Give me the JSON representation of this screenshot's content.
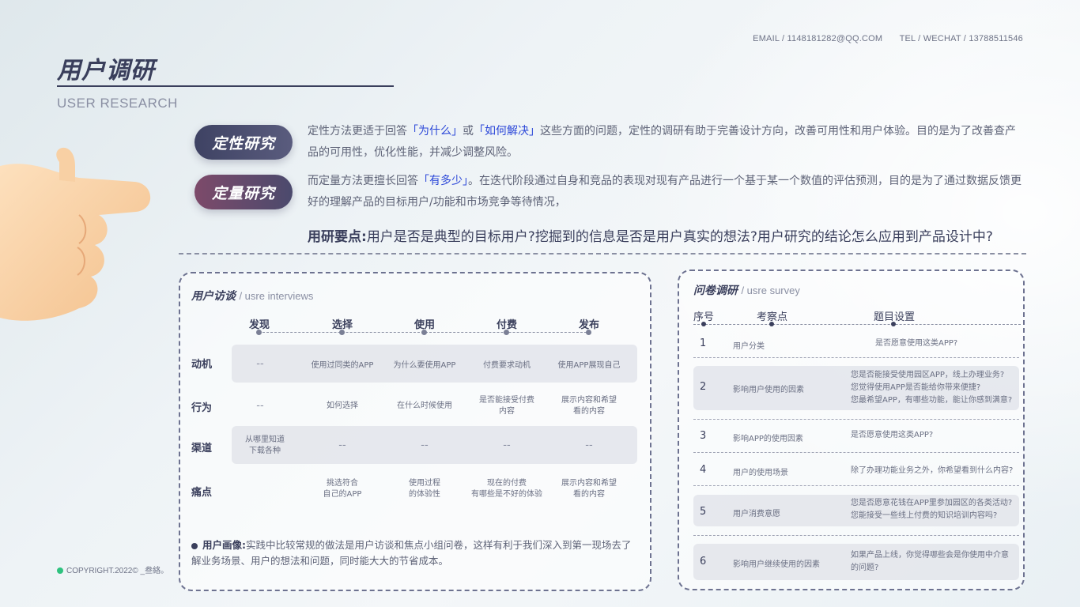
{
  "header": {
    "email": "EMAIL / 1148181282@QQ.COM",
    "tel": "TEL / WECHAT / 13788511546"
  },
  "title": "用户调研",
  "subtitle": "USER RESEARCH",
  "qualitative": {
    "badge": "定性研究",
    "t1": "定性方法更适于回答",
    "h1": "「为什么」",
    "t2": "或",
    "h2": "「如何解决」",
    "t3": "这些方面的问题，定性的调研有助于完善设计方向，改善可用性和用户体验。目的是为了改善查产品的可用性，优化性能，并减少调整风险。"
  },
  "quantitative": {
    "badge": "定量研究",
    "t1": "而定量方法更擅长回答",
    "h1": "「有多少」",
    "t2": "。在迭代阶段通过自身和竞品的表现对现有产品进行一个基于某一个数值的评估预测，目的是为了通过数据反馈更好的理解产品的目标用户/功能和市场竞争等待情况，"
  },
  "keypoint": {
    "label": "用研要点:",
    "text": "用户是否是典型的目标用户?挖掘到的信息是否是用户真实的想法?用户研究的结论怎么应用到产品设计中?"
  },
  "interviews": {
    "title": "用户访谈",
    "subtitle": "/ usre interviews",
    "stages": [
      "发现",
      "选择",
      "使用",
      "付费",
      "发布"
    ],
    "rows": [
      {
        "label": "动机",
        "cells": [
          "--",
          "使用过同类的APP",
          "为什么要使用APP",
          "付费要求动机",
          "使用APP展现自己"
        ]
      },
      {
        "label": "行为",
        "cells": [
          "--",
          "如何选择",
          "在什么时候使用",
          "是否能接受付费\n内容",
          "展示内容和希望\n看的内容"
        ]
      },
      {
        "label": "渠道",
        "cells": [
          "从哪里知道\n下载各种",
          "--",
          "--",
          "--",
          "--"
        ]
      },
      {
        "label": "痛点",
        "cells": [
          "",
          "挑选符合\n自己的APP",
          "使用过程\n的体验性",
          "现在的付费\n有哪些是不好的体验",
          "展示内容和希望\n看的内容"
        ]
      }
    ],
    "note_label": "用户画像:",
    "note_text": "实践中比较常规的做法是用户访谈和焦点小组问卷，这样有利于我们深入到第一现场去了解业务场景、用户的想法和问题，同时能大大的节省成本。"
  },
  "survey": {
    "title": "问卷调研",
    "subtitle": "/ usre survey",
    "headers": [
      "序号",
      "考察点",
      "题目设置"
    ],
    "rows": [
      {
        "no": "1",
        "point": "用户分类",
        "question": "是否愿意使用这类APP?"
      },
      {
        "no": "2",
        "point": "影响用户使用的因素",
        "question": "您是否能接受使用园区APP，线上办理业务?\n您觉得使用APP是否能给你带来便捷?\n您最希望APP，有哪些功能，能让你感到满意?"
      },
      {
        "no": "3",
        "point": "影响APP的使用因素",
        "question": "是否愿意使用这类APP?"
      },
      {
        "no": "4",
        "point": "用户的使用场景",
        "question": "除了办理功能业务之外，你希望看到什么内容?"
      },
      {
        "no": "5",
        "point": "用户消费意愿",
        "question": "您是否愿意花钱在APP里参加园区的各类活动?\n您能接受一些线上付费的知识培训内容吗?"
      },
      {
        "no": "6",
        "point": "影响用户继续使用的因素",
        "question": "如果产品上线，你觉得哪些会是你使用中介意\n的问题?"
      }
    ]
  },
  "copyright": "COPYRIGHT.2022© _叁絡。"
}
